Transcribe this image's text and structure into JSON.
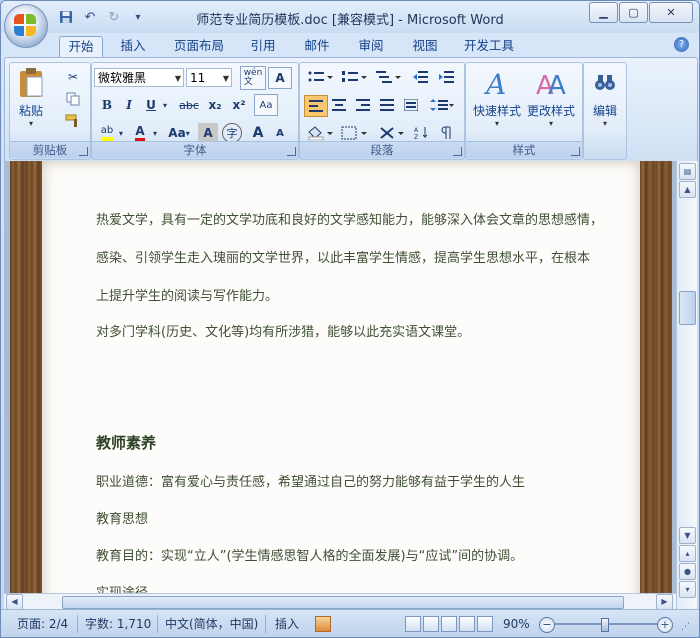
{
  "window": {
    "title": "师范专业简历模板.doc [兼容模式] - Microsoft Word",
    "controls": {
      "minimize": "▁",
      "maximize": "▢",
      "close": "✕"
    }
  },
  "quick_access": {
    "save_icon": "floppy-icon",
    "undo_symbol": "↶",
    "redo_symbol": "↻",
    "customize_symbol": "▾"
  },
  "tabs": [
    "开始",
    "插入",
    "页面布局",
    "引用",
    "邮件",
    "审阅",
    "视图",
    "开发工具"
  ],
  "active_tab": "开始",
  "help_symbol": "?",
  "ribbon": {
    "clipboard": {
      "paste_label": "粘贴",
      "group_label": "剪贴板"
    },
    "font": {
      "font_name": "微软雅黑",
      "font_size": "11",
      "wen_label": "wén\n文",
      "bold": "B",
      "italic": "I",
      "underline": "U",
      "strike": "abc",
      "subscript": "x₂",
      "superscript": "x²",
      "aa": "Aa",
      "char_shade": "A",
      "enclose": "字",
      "grow": "A",
      "shrink": "A",
      "group_label": "字体"
    },
    "paragraph": {
      "group_label": "段落"
    },
    "styles": {
      "quick_styles": "快速样式",
      "change_styles": "更改样式",
      "group_label": "样式"
    },
    "editing": {
      "label": "编辑"
    }
  },
  "document": {
    "paragraphs": [
      "热爱文学，具有一定的文学功底和良好的文学感知能力，能够深入体会文章的思想感情，",
      "感染、引领学生走入瑰丽的文学世界，以此丰富学生情感，提高学生思想水平，在根本",
      "上提升学生的阅读与写作能力。",
      "对多门学科(历史、文化等)均有所涉猎，能够以此充实语文课堂。"
    ],
    "heading": "教师素养",
    "paragraphs2": [
      "职业道德：富有爱心与责任感，希望通过自己的努力能够有益于学生的人生",
      "教育思想",
      "教育目的：实现“立人”(学生情感思智人格的全面发展)与“应试”间的协调。",
      "实现途径"
    ]
  },
  "status_bar": {
    "page": "页面: 2/4",
    "words": "字数: 1,710",
    "language": "中文(简体，中国)",
    "insert": "插入",
    "zoom": "90%",
    "zoom_level_percent": 90
  },
  "colors": {
    "ribbon_bg": "#dbe8f7",
    "text_green": "#3f4f35",
    "highlight": "#ffff00",
    "font_color_red": "#e01010"
  }
}
